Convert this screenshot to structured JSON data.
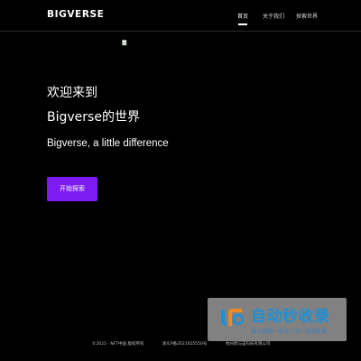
{
  "header": {
    "logo": "BIGVERSE",
    "nav": [
      {
        "label": "首页",
        "active": true
      },
      {
        "label": "关于我们",
        "active": false
      },
      {
        "label": "探索世界",
        "active": false
      }
    ]
  },
  "hero": {
    "line1": "欢迎来到",
    "line2": "Bigverse的世界",
    "subtitle": "Bigverse, a little difference",
    "cta_label": "开始探索"
  },
  "footer": {
    "copyright": "©2021 - NFT中国 版权所有",
    "icp": "浙ICP备2021025550号",
    "company": "杭州原与宙科技有限公司"
  },
  "watermark": {
    "title": "自动秒收录",
    "slogan": "做上链接一来访一次一自动收录"
  },
  "colors": {
    "background": "#000000",
    "accent": "#7c1cf2",
    "text": "#ffffff"
  }
}
